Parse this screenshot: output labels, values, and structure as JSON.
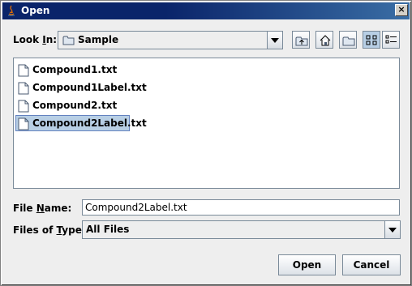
{
  "window": {
    "title": "Open",
    "close_glyph": "×"
  },
  "look_in": {
    "label_pre": "Look ",
    "label_mnemonic": "I",
    "label_post": "n:",
    "value": "Sample"
  },
  "toolbar": {
    "buttons": [
      {
        "name": "up-one-level",
        "icon": "folder-up-icon"
      },
      {
        "name": "home",
        "icon": "home-icon"
      },
      {
        "name": "new-folder",
        "icon": "new-folder-icon"
      },
      {
        "name": "list-view",
        "icon": "list-view-icon",
        "active": true
      },
      {
        "name": "details-view",
        "icon": "details-view-icon"
      }
    ]
  },
  "files": [
    {
      "name": "Compound1.txt",
      "selected": false
    },
    {
      "name": "Compound1Label.txt",
      "selected": false
    },
    {
      "name": "Compound2.txt",
      "selected": false
    },
    {
      "name": "Compound2Label.txt",
      "selected": true
    }
  ],
  "file_name": {
    "label_pre": "File ",
    "label_mnemonic": "N",
    "label_post": "ame:",
    "value": "Compound2Label.txt"
  },
  "file_type": {
    "label_pre": "Files of ",
    "label_mnemonic": "T",
    "label_post": "ype:",
    "value": "All Files"
  },
  "actions": {
    "open_label": "Open",
    "cancel_label": "Cancel"
  },
  "colors": {
    "title_bar": "#0a246a",
    "selection": "#b8cfe5",
    "border": "#7a8a99"
  }
}
